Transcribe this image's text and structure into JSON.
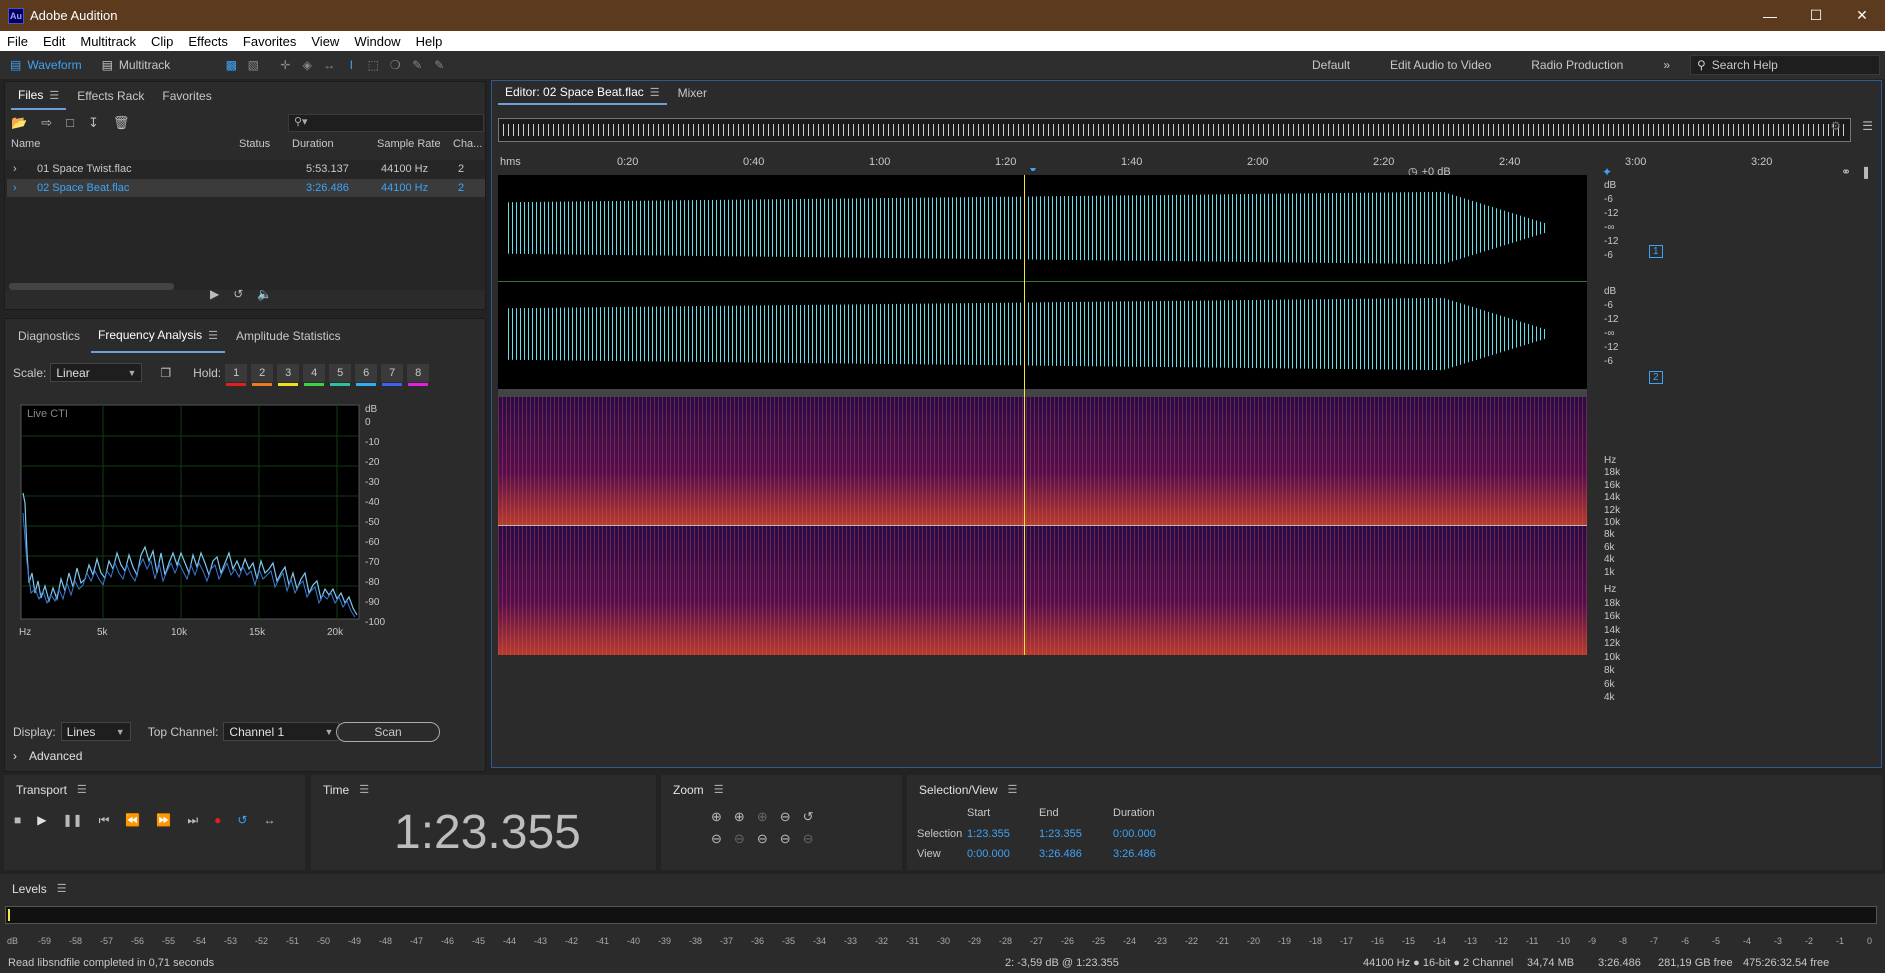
{
  "window": {
    "title": "Adobe Audition",
    "logo": "Au"
  },
  "menu": [
    "File",
    "Edit",
    "Multitrack",
    "Clip",
    "Effects",
    "Favorites",
    "View",
    "Window",
    "Help"
  ],
  "toolbar": {
    "waveform": "Waveform",
    "multitrack": "Multitrack",
    "workspaces": [
      "Default",
      "Edit Audio to Video",
      "Radio Production"
    ],
    "search_placeholder": "Search Help"
  },
  "files_panel": {
    "tabs": [
      "Files",
      "Effects Rack",
      "Favorites"
    ],
    "columns": [
      "Name",
      "Status",
      "Duration",
      "Sample Rate",
      "Cha..."
    ],
    "rows": [
      {
        "name": "01 Space Twist.flac",
        "duration": "5:53.137",
        "rate": "44100 Hz",
        "ch": "2",
        "selected": false
      },
      {
        "name": "02 Space Beat.flac",
        "duration": "3:26.486",
        "rate": "44100 Hz",
        "ch": "2",
        "selected": true
      }
    ]
  },
  "analysis_panel": {
    "tabs": [
      "Diagnostics",
      "Frequency Analysis",
      "Amplitude Statistics"
    ],
    "scale_label": "Scale:",
    "scale_value": "Linear",
    "hold_label": "Hold:",
    "holds": [
      "1",
      "2",
      "3",
      "4",
      "5",
      "6",
      "7",
      "8"
    ],
    "hold_colors": [
      "#e02020",
      "#f07820",
      "#f0e020",
      "#40d040",
      "#30c0a0",
      "#30b0f0",
      "#4060f0",
      "#e020e0"
    ],
    "live_label": "Live CTI",
    "db_ticks": [
      "dB",
      "0",
      "-10",
      "-20",
      "-30",
      "-40",
      "-50",
      "-60",
      "-70",
      "-80",
      "-90",
      "-100"
    ],
    "hz_ticks": [
      "Hz",
      "5k",
      "10k",
      "15k",
      "20k"
    ],
    "display_label": "Display:",
    "display_value": "Lines",
    "top_channel_label": "Top Channel:",
    "top_channel_value": "Channel 1",
    "scan": "Scan",
    "advanced": "Advanced"
  },
  "editor": {
    "tab": "Editor: 02 Space Beat.flac",
    "mixer": "Mixer",
    "time_ticks": [
      "hms",
      "0:20",
      "0:40",
      "1:00",
      "1:20",
      "1:40",
      "2:00",
      "2:20",
      "2:40",
      "3:00",
      "3:20"
    ],
    "gain": "+0 dB",
    "db_ticks": [
      "dB",
      "-6",
      "-12",
      "-∞",
      "-12",
      "-6"
    ],
    "hz_ticks": [
      "Hz",
      "18k",
      "16k",
      "14k",
      "12k",
      "10k",
      "8k",
      "6k",
      "4k",
      "1k"
    ],
    "channels": [
      "1",
      "2"
    ]
  },
  "transport": {
    "title": "Transport"
  },
  "time": {
    "title": "Time",
    "value": "1:23.355"
  },
  "zoom": {
    "title": "Zoom"
  },
  "selection": {
    "title": "Selection/View",
    "headers": [
      "Start",
      "End",
      "Duration"
    ],
    "rows": [
      {
        "label": "Selection",
        "start": "1:23.355",
        "end": "1:23.355",
        "duration": "0:00.000"
      },
      {
        "label": "View",
        "start": "0:00.000",
        "end": "3:26.486",
        "duration": "3:26.486"
      }
    ]
  },
  "levels": {
    "title": "Levels",
    "ticks": [
      "dB",
      "-59",
      "-58",
      "-57",
      "-56",
      "-55",
      "-54",
      "-53",
      "-52",
      "-51",
      "-50",
      "-49",
      "-48",
      "-47",
      "-46",
      "-45",
      "-44",
      "-43",
      "-42",
      "-41",
      "-40",
      "-39",
      "-38",
      "-37",
      "-36",
      "-35",
      "-34",
      "-33",
      "-32",
      "-31",
      "-30",
      "-29",
      "-28",
      "-27",
      "-26",
      "-25",
      "-24",
      "-23",
      "-22",
      "-21",
      "-20",
      "-19",
      "-18",
      "-17",
      "-16",
      "-15",
      "-14",
      "-13",
      "-12",
      "-11",
      "-10",
      "-9",
      "-8",
      "-7",
      "-6",
      "-5",
      "-4",
      "-3",
      "-2",
      "-1",
      "0"
    ]
  },
  "status": {
    "left": "Read libsndfile completed in 0,71 seconds",
    "cursor": "2: -3,59 dB @ 1:23.355",
    "format": "44100 Hz ● 16-bit ● 2 Channel",
    "size": "34,74 MB",
    "duration": "3:26.486",
    "free": "281,19 GB free",
    "free_time": "475:26:32.54 free"
  }
}
